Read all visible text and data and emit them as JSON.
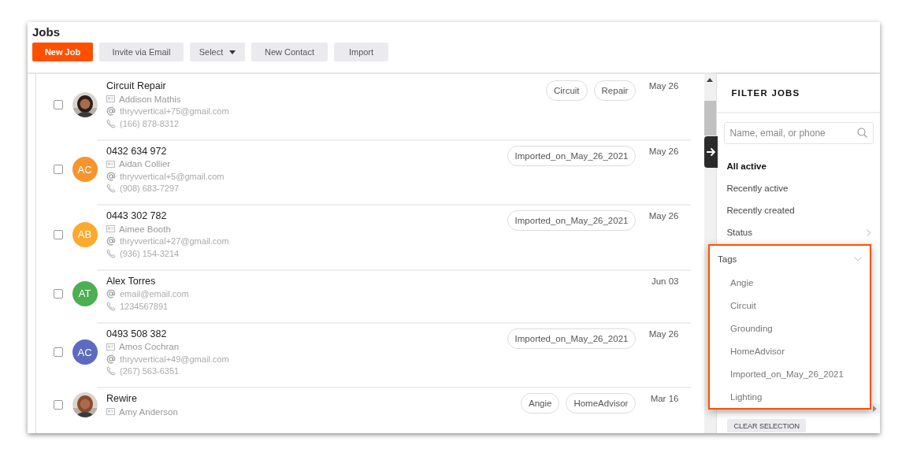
{
  "window": {
    "title": "Jobs"
  },
  "toolbar": [
    {
      "label": "New Job",
      "kind": "primary"
    },
    {
      "label": "Invite via Email",
      "kind": "plain"
    },
    {
      "label": "Select",
      "kind": "dropdown"
    },
    {
      "label": "New Contact",
      "kind": "plain"
    },
    {
      "label": "Import",
      "kind": "plain"
    }
  ],
  "jobs": [
    {
      "checked": false,
      "title": "Circuit Repair",
      "contact": "Addison Mathis",
      "email": "thryvvertical+75@gmail.com",
      "phone": "(166) 878-8312",
      "tags": [
        "Circuit",
        "Repair"
      ],
      "date": "May 26"
    },
    {
      "checked": false,
      "avatar": {
        "kind": "initials",
        "initials": "AC",
        "color": "#f7942c"
      },
      "title": "0432 634 972",
      "contact": "Aidan Collier",
      "email": "thryvvertical+5@gmail.com",
      "phone": "(908) 683-7297",
      "tags": [
        "Imported_on_May_26_2021"
      ],
      "date": "May 26"
    },
    {
      "checked": false,
      "avatar": {
        "kind": "initials",
        "initials": "AB",
        "color": "#fba92f"
      },
      "title": "0443 302 782",
      "contact": "Aimee Booth",
      "email": "thryvvertical+27@gmail.com",
      "phone": "(936) 154-3214",
      "tags": [
        "Imported_on_May_26_2021"
      ],
      "date": "May 26"
    },
    {
      "checked": false,
      "avatar": {
        "kind": "initials",
        "initials": "AT",
        "color": "#4caf50"
      },
      "title": "Alex Torres",
      "email": "email@email.com",
      "phone": "1234567891",
      "date": "Jun 03"
    },
    {
      "checked": false,
      "avatar": {
        "kind": "initials",
        "initials": "AC",
        "color": "#5c6bc0"
      },
      "title": "0493 508 382",
      "contact": "Amos Cochran",
      "email": "thryvvertical+49@gmail.com",
      "phone": "(267) 563-6351",
      "tags": [
        "Imported_on_May_26_2021"
      ],
      "date": "May 26"
    },
    {
      "checked": false,
      "title": "Rewire",
      "contact": "Amy Anderson",
      "tags": [
        "Angie",
        "HomeAdvisor"
      ],
      "date": "Mar 16"
    }
  ],
  "filter": {
    "title": "FILTER JOBS",
    "search": {
      "placeholder": "Name, email, or phone"
    },
    "items": [
      {
        "label": "All active",
        "selected": true,
        "kind": "plain"
      },
      {
        "label": "Recently active",
        "selected": false,
        "kind": "plain"
      },
      {
        "label": "Recently created",
        "selected": false,
        "kind": "plain"
      },
      {
        "label": "Status",
        "selected": false,
        "kind": "submenu"
      }
    ],
    "clear_button": "CLEAR SELECTION"
  },
  "tags_menu": {
    "title": "Tags",
    "expanded": true,
    "options": [
      "Angie",
      "Circuit",
      "Grounding",
      "HomeAdvisor",
      "Imported_on_May_26_2021",
      "Lighting"
    ]
  }
}
